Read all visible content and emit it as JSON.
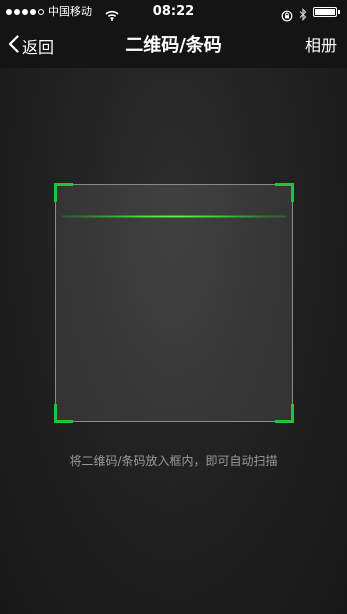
{
  "status_bar": {
    "carrier": "中国移动",
    "time": "08:22",
    "icons": [
      "signal-icon",
      "wifi-icon",
      "rotation-lock-icon",
      "bluetooth-icon",
      "battery-icon"
    ]
  },
  "nav": {
    "back_label": "返回",
    "title": "二维码/条码",
    "album_label": "相册"
  },
  "scanner": {
    "hint": "将二维码/条码放入框内，即可自动扫描",
    "accent_color": "#22c33c"
  }
}
